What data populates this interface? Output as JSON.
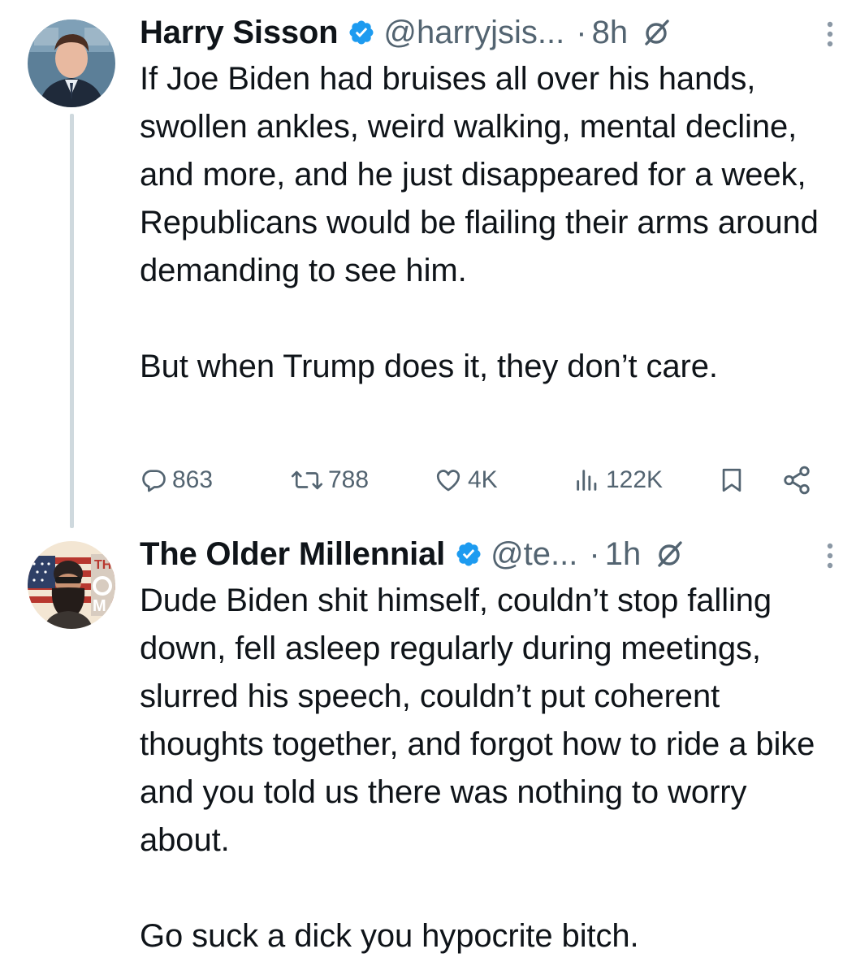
{
  "tweets": [
    {
      "author_name": "Harry Sisson",
      "handle": "@harryjsis...",
      "separator": "·",
      "time": "8h",
      "text": "If Joe Biden had bruises all over his hands, swollen ankles, weird walking, mental decline, and more, and he just disappeared for a week, Republicans would be flailing their arms around demanding to see him.\n\nBut when Trump does it, they don’t care.",
      "verified": true,
      "stats": {
        "replies": "863",
        "retweets": "788",
        "likes": "4K",
        "views": "122K"
      }
    },
    {
      "author_name": "The Older Millennial",
      "handle": "@te...",
      "separator": "·",
      "time": "1h",
      "text": "Dude Biden shit himself, couldn’t stop falling down, fell asleep regularly during meetings, slurred his speech, couldn’t put coherent thoughts together, and forgot how to ride a bike and you told us there was nothing to worry about.\n\nGo suck a dick you hypocrite bitch.",
      "verified": true,
      "avatar_text": "THE O M"
    }
  ],
  "colors": {
    "text": "#0f1419",
    "secondary": "#536471",
    "verified_blue": "#1d9bf0",
    "thread_line": "#cfd9de"
  },
  "icons": [
    "verified-badge-icon",
    "grok-icon",
    "more-icon",
    "reply-icon",
    "retweet-icon",
    "like-icon",
    "views-icon",
    "bookmark-icon",
    "share-icon"
  ]
}
